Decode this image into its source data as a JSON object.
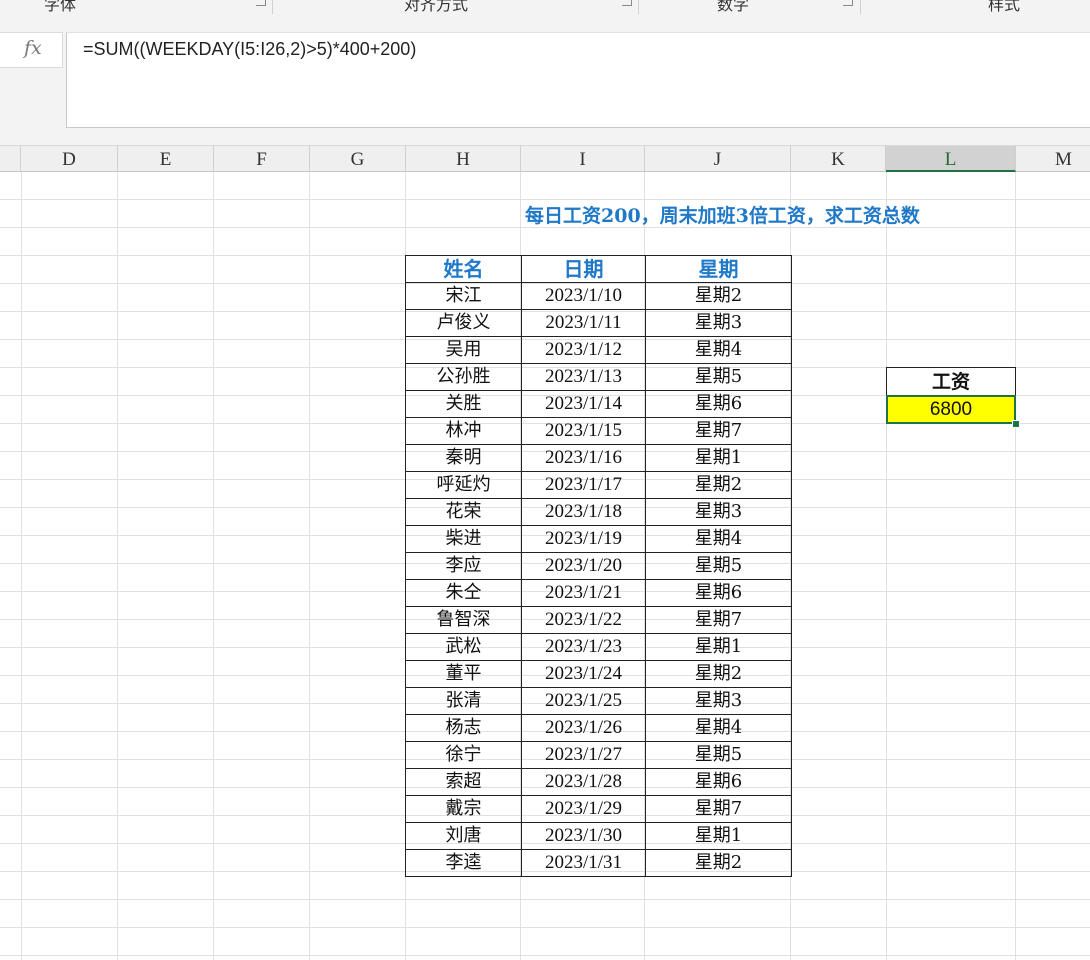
{
  "ribbon": {
    "groups": [
      "字体",
      "对齐方式",
      "数字",
      "样式"
    ]
  },
  "formula_bar": {
    "fx_label": "fx",
    "formula": "=SUM((WEEKDAY(I5:I26,2)>5)*400+200)"
  },
  "columns": [
    "D",
    "E",
    "F",
    "G",
    "H",
    "I",
    "J",
    "K",
    "L",
    "M"
  ],
  "active_column": "L",
  "title": "每日工资200，周末加班3倍工资，求工资总数",
  "table": {
    "headers": [
      "姓名",
      "日期",
      "星期"
    ],
    "rows": [
      [
        "宋江",
        "2023/1/10",
        "星期2"
      ],
      [
        "卢俊义",
        "2023/1/11",
        "星期3"
      ],
      [
        "吴用",
        "2023/1/12",
        "星期4"
      ],
      [
        "公孙胜",
        "2023/1/13",
        "星期5"
      ],
      [
        "关胜",
        "2023/1/14",
        "星期6"
      ],
      [
        "林冲",
        "2023/1/15",
        "星期7"
      ],
      [
        "秦明",
        "2023/1/16",
        "星期1"
      ],
      [
        "呼延灼",
        "2023/1/17",
        "星期2"
      ],
      [
        "花荣",
        "2023/1/18",
        "星期3"
      ],
      [
        "柴进",
        "2023/1/19",
        "星期4"
      ],
      [
        "李应",
        "2023/1/20",
        "星期5"
      ],
      [
        "朱仝",
        "2023/1/21",
        "星期6"
      ],
      [
        "鲁智深",
        "2023/1/22",
        "星期7"
      ],
      [
        "武松",
        "2023/1/23",
        "星期1"
      ],
      [
        "董平",
        "2023/1/24",
        "星期2"
      ],
      [
        "张清",
        "2023/1/25",
        "星期3"
      ],
      [
        "杨志",
        "2023/1/26",
        "星期4"
      ],
      [
        "徐宁",
        "2023/1/27",
        "星期5"
      ],
      [
        "索超",
        "2023/1/28",
        "星期6"
      ],
      [
        "戴宗",
        "2023/1/29",
        "星期7"
      ],
      [
        "刘唐",
        "2023/1/30",
        "星期1"
      ],
      [
        "李逵",
        "2023/1/31",
        "星期2"
      ]
    ]
  },
  "salary": {
    "label": "工资",
    "value": "6800"
  },
  "colors": {
    "accent_blue": "#1f78c8",
    "selection_green": "#217346",
    "highlight_yellow": "#ffff00"
  }
}
